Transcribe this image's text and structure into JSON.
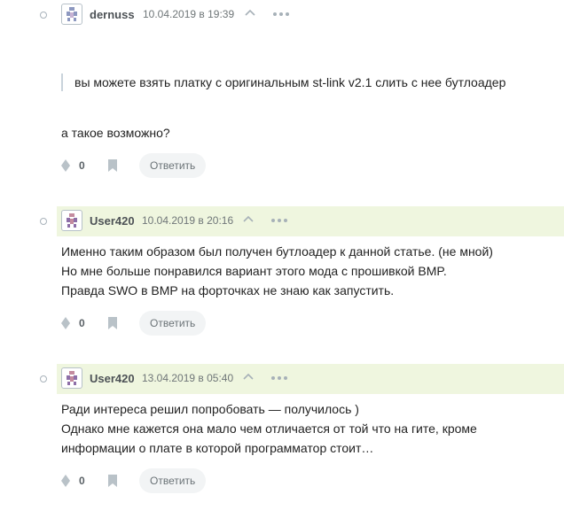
{
  "comments": [
    {
      "author": "dernuss",
      "timestamp": "10.04.2019 в 19:39",
      "highlighted": false,
      "quote": "вы можете взять платку с оригинальным st-link v2.1 слить с нее бутлоадер",
      "lines": [
        "а такое возможно?"
      ],
      "score": "0",
      "reply_label": "Ответить"
    },
    {
      "author": "User420",
      "timestamp": "10.04.2019 в 20:16",
      "highlighted": true,
      "lines": [
        "Именно таким образом был получен бутлоадер к данной статье. (не мной)",
        "Но мне больше понравился вариант этого мода с прошивкой BMP.",
        "Правда SWO в BMP на форточках не знаю как запустить."
      ],
      "score": "0",
      "reply_label": "Ответить"
    },
    {
      "author": "User420",
      "timestamp": "13.04.2019 в 05:40",
      "highlighted": true,
      "lines": [
        "Ради интереса решил попробовать — получилось )",
        "Однако мне кажется она мало чем отличается от той что на гите, кроме",
        "информации о плате в которой программатор стоит…"
      ],
      "score": "0",
      "reply_label": "Ответить"
    }
  ],
  "colors": {
    "highlight_bg": "#eff6df",
    "text": "#222222",
    "meta": "#6f7678",
    "button_bg": "#f2f4f5"
  },
  "icons": {
    "avatar": "identicon-avatar-icon",
    "thread": "thread-dot-icon",
    "up": "chevron-up-icon",
    "more": "ellipsis-icon",
    "vote": "vote-diamond-icon",
    "bookmark": "bookmark-icon"
  }
}
